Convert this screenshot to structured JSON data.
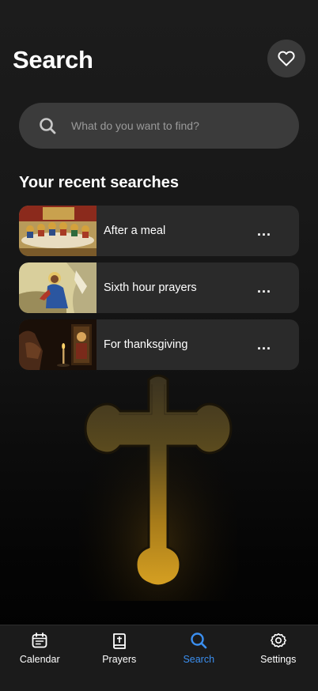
{
  "header": {
    "title": "Search",
    "favorite_icon": "heart-icon"
  },
  "search": {
    "placeholder": "What do you want to find?",
    "value": "",
    "icon": "search-icon"
  },
  "recent": {
    "title": "Your recent searches",
    "items": [
      {
        "label": "After a meal",
        "thumb": "last-supper-icon-image",
        "more": "..."
      },
      {
        "label": "Sixth hour prayers",
        "thumb": "praying-christ-image",
        "more": "..."
      },
      {
        "label": "For thanksgiving",
        "thumb": "candle-icon-image",
        "more": "..."
      }
    ]
  },
  "tabbar": {
    "tabs": [
      {
        "label": "Calendar",
        "icon": "calendar-icon",
        "active": false
      },
      {
        "label": "Prayers",
        "icon": "prayer-book-icon",
        "active": false
      },
      {
        "label": "Search",
        "icon": "search-icon",
        "active": true
      },
      {
        "label": "Settings",
        "icon": "gear-icon",
        "active": false
      }
    ]
  },
  "colors": {
    "background": "#1c1c1c",
    "card": "#2a2a2a",
    "search_field": "#3b3b3b",
    "accent": "#3b8ff0",
    "cross_gold": "#c8921a"
  }
}
